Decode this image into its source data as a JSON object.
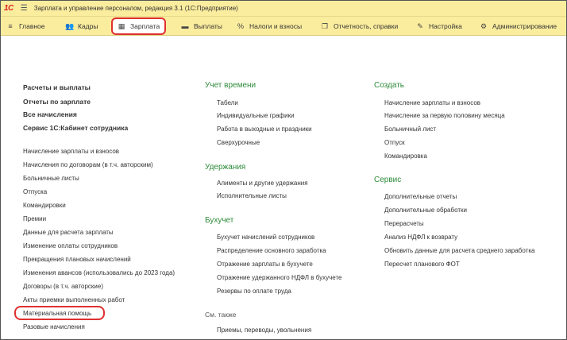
{
  "window": {
    "title": "Зарплата и управление персоналом, редакция 3.1  (1С:Предприятие)",
    "logo": "1С",
    "icons": [
      "menu-icon"
    ]
  },
  "menubar": {
    "items": [
      {
        "label": "Главное",
        "icon": "hamburger-icon",
        "glyph": "≡"
      },
      {
        "label": "Кадры",
        "icon": "people-icon",
        "glyph": "👥"
      },
      {
        "label": "Зарплата",
        "icon": "calculator-icon",
        "glyph": "▦",
        "active": true
      },
      {
        "label": "Выплаты",
        "icon": "card-icon",
        "glyph": "▬"
      },
      {
        "label": "Налоги и взносы",
        "icon": "percent-icon",
        "glyph": "%"
      },
      {
        "label": "Отчетность, справки",
        "icon": "documents-icon",
        "glyph": "❐"
      },
      {
        "label": "Настройка",
        "icon": "wrench-icon",
        "glyph": "✎"
      },
      {
        "label": "Администрирование",
        "icon": "gear-icon",
        "glyph": "⚙"
      }
    ]
  },
  "left_column": {
    "bold_links": [
      "Расчеты и выплаты",
      "Отчеты по зарплате",
      "Все начисления",
      "Сервис 1С:Кабинет сотрудника"
    ],
    "links": [
      "Начисление зарплаты и взносов",
      "Начисления по договорам (в т.ч. авторским)",
      "Больничные листы",
      "Отпуска",
      "Командировки",
      "Премии",
      "Данные для расчета зарплаты",
      "Изменение оплаты сотрудников",
      "Прекращения плановых начислений",
      "Изменения авансов (использовались до 2023 года)",
      "Договоры (в т.ч. авторские)",
      "Акты приемки выполненных работ",
      "Материальная помощь",
      "Разовые начисления"
    ]
  },
  "middle_column": {
    "sections": [
      {
        "title": "Учет времени",
        "links": [
          "Табели",
          "Индивидуальные графики",
          "Работа в выходные и праздники",
          "Сверхурочные"
        ]
      },
      {
        "title": "Удержания",
        "links": [
          "Алименты и другие удержания",
          "Исполнительные листы"
        ]
      },
      {
        "title": "Бухучет",
        "links": [
          "Бухучет начислений сотрудников",
          "Распределение основного заработка",
          "Отражение зарплаты в бухучете",
          "Отражение удержанного НДФЛ в бухучете",
          "Резервы по оплате труда"
        ]
      }
    ],
    "see_also": {
      "title": "См. также",
      "links": [
        "Приемы, переводы, увольнения"
      ]
    }
  },
  "right_column": {
    "sections": [
      {
        "title": "Создать",
        "links": [
          "Начисление зарплаты и взносов",
          "Начисление за первую половину месяца",
          "Больничный лист",
          "Отпуск",
          "Командировка"
        ]
      },
      {
        "title": "Сервис",
        "links": [
          "Дополнительные отчеты",
          "Дополнительные обработки",
          "Перерасчеты",
          "Анализ НДФЛ к возврату",
          "Обновить данные для расчета среднего заработка",
          "Пересчет планового ФОТ"
        ]
      }
    ]
  },
  "colors": {
    "bar_bg": "#fbed9e",
    "section_green": "#2e8b3a",
    "highlight_red": "#e03030"
  }
}
